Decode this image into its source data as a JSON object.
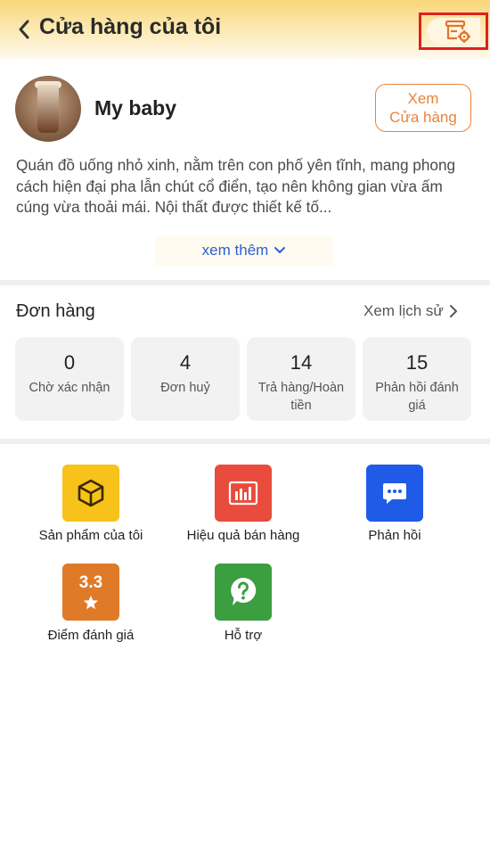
{
  "header": {
    "title": "Cửa hàng của tôi",
    "back_icon": "chevron-left-icon",
    "settings_icon": "store-settings-icon"
  },
  "profile": {
    "shop_name": "My baby",
    "view_store_line1": "Xem",
    "view_store_line2": "Cửa hàng",
    "description": "Quán đồ uống nhỏ xinh, nằm trên con phố yên tĩnh, mang phong cách hiện đại pha lẫn chút cổ điển, tạo nên không gian vừa ấm cúng vừa thoải mái. Nội thất được thiết kế tố...",
    "see_more": "xem thêm"
  },
  "orders": {
    "title": "Đơn hàng",
    "history_link": "Xem lịch sử",
    "stats": [
      {
        "value": "0",
        "label": "Chờ xác nhận"
      },
      {
        "value": "4",
        "label": "Đơn huỷ"
      },
      {
        "value": "14",
        "label": "Trả hàng/Hoàn tiền"
      },
      {
        "value": "15",
        "label": "Phản hồi đánh giá"
      }
    ]
  },
  "features": [
    {
      "label": "Sản phẩm của tôi",
      "icon": "box-icon",
      "color": "#f7c21a"
    },
    {
      "label": "Hiệu quả bán hàng",
      "icon": "bar-chart-icon",
      "color": "#e94b3c"
    },
    {
      "label": "Phản hồi",
      "icon": "chat-icon",
      "color": "#1f5be6"
    },
    {
      "label": "Điểm đánh giá",
      "icon": "rating-star-icon",
      "color": "#de7a28",
      "rating": "3.3"
    },
    {
      "label": "Hỗ trợ",
      "icon": "help-icon",
      "color": "#3b9e3f"
    }
  ],
  "colors": {
    "accent": "#e9833e",
    "link": "#2f5fd0",
    "highlight_border": "#e0201e"
  }
}
